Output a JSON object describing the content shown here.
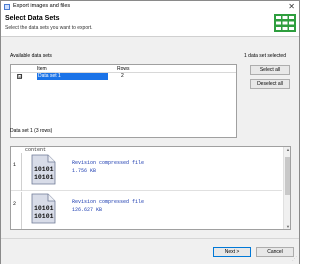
{
  "window": {
    "title": "Export images and files",
    "close_glyph": "✕"
  },
  "header": {
    "title": "Select Data Sets",
    "subtitle": "Select the data sets you want to export."
  },
  "datasets": {
    "label": "Available data sets",
    "selected_count_text": "1 data set selected",
    "columns": {
      "item": "Item",
      "rows": "Rows"
    },
    "rows": [
      {
        "checked": true,
        "check_glyph": "☑",
        "name": "Data set 1",
        "rows": "2"
      }
    ],
    "select_all_label": "Select all",
    "deselect_all_label": "Deselect all"
  },
  "preview": {
    "label": "Data set 1 (3 rows)",
    "column_header": "content",
    "rows": [
      {
        "num": "1",
        "line1": "Revision compressed file",
        "line2": "1.756 KB",
        "icon_text": [
          "10101",
          "10101"
        ]
      },
      {
        "num": "2",
        "line1": "Revision compressed file",
        "line2": "126.627 KB",
        "icon_text": [
          "10101",
          "10101"
        ]
      }
    ]
  },
  "footer": {
    "next_label": "Next >",
    "cancel_label": "Cancel"
  },
  "colors": {
    "accent": "#1a73e8",
    "file_text": "#1b3bb0",
    "grid_icon": "#2e9e3e"
  }
}
